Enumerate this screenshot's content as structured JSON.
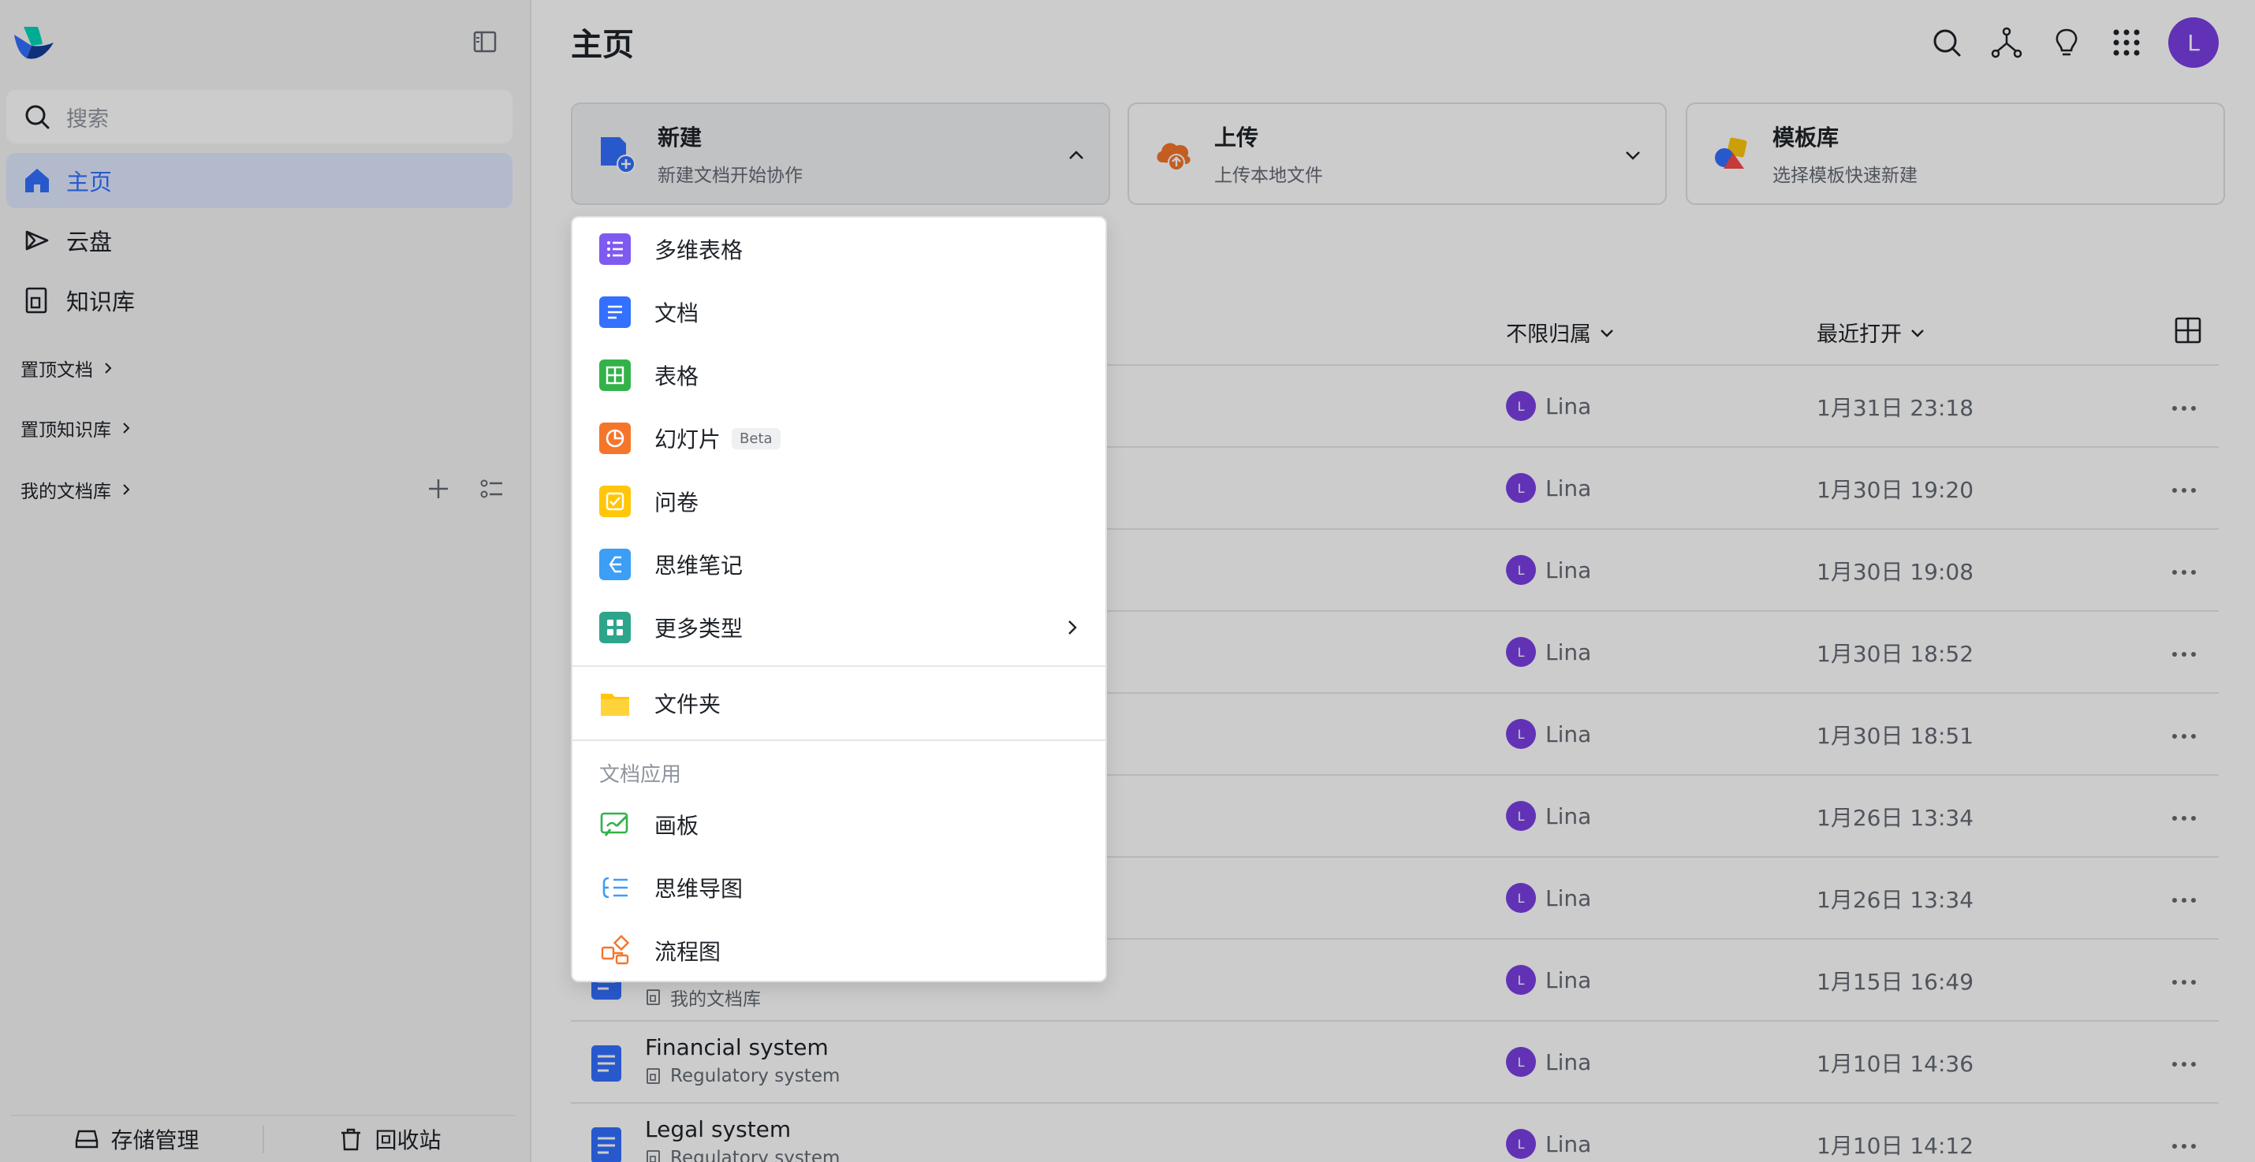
{
  "sidebar": {
    "search_placeholder": "搜索",
    "nav": [
      {
        "label": "主页",
        "icon": "home-icon",
        "active": true
      },
      {
        "label": "云盘",
        "icon": "cloud-drive-icon",
        "active": false
      },
      {
        "label": "知识库",
        "icon": "wiki-icon",
        "active": false
      }
    ],
    "sections": [
      "置顶文档",
      "置顶知识库",
      "我的文档库"
    ],
    "bottom": {
      "storage": "存储管理",
      "trash": "回收站"
    }
  },
  "header": {
    "title": "主页",
    "avatar_initial": "L"
  },
  "cards": [
    {
      "title": "新建",
      "subtitle": "新建文档开始协作",
      "icon": "new-doc-icon"
    },
    {
      "title": "上传",
      "subtitle": "上传本地文件",
      "icon": "upload-cloud-icon"
    },
    {
      "title": "模板库",
      "subtitle": "选择模板快速新建",
      "icon": "template-shapes-icon"
    }
  ],
  "table": {
    "col_owner": "不限归属",
    "col_time": "最近打开",
    "rows": [
      {
        "name": "",
        "location": "",
        "owner": "Lina",
        "time": "1月31日 23:18"
      },
      {
        "name": "",
        "location": "",
        "owner": "Lina",
        "time": "1月30日 19:20"
      },
      {
        "name": "",
        "location": "",
        "owner": "Lina",
        "time": "1月30日 19:08"
      },
      {
        "name": "",
        "location": "",
        "owner": "Lina",
        "time": "1月30日 18:52"
      },
      {
        "name": "",
        "location": "",
        "owner": "Lina",
        "time": "1月30日 18:51"
      },
      {
        "name": "",
        "location": "",
        "owner": "Lina",
        "time": "1月26日 13:34"
      },
      {
        "name": "",
        "location": "",
        "owner": "Lina",
        "time": "1月26日 13:34"
      },
      {
        "name": "",
        "location": "我的文档库",
        "owner": "Lina",
        "time": "1月15日 16:49"
      },
      {
        "name": "Financial system",
        "location": "Regulatory system",
        "owner": "Lina",
        "time": "1月10日 14:36"
      },
      {
        "name": "Legal system",
        "location": "Regulatory system",
        "owner": "Lina",
        "time": "1月10日 14:12"
      }
    ]
  },
  "dropdown": {
    "items": [
      {
        "label": "多维表格",
        "icon": "base-icon",
        "color": "#7f5af0"
      },
      {
        "label": "文档",
        "icon": "doc-icon",
        "color": "#3370ff"
      },
      {
        "label": "表格",
        "icon": "sheet-icon",
        "color": "#34b24a"
      },
      {
        "label": "幻灯片",
        "icon": "slides-icon",
        "color": "#f5752a",
        "badge": "Beta"
      },
      {
        "label": "问卷",
        "icon": "survey-icon",
        "color": "#ffc60a"
      },
      {
        "label": "思维笔记",
        "icon": "mindnote-icon",
        "color": "#3d9ef5"
      },
      {
        "label": "更多类型",
        "icon": "more-types-icon",
        "color": "#2ea58b"
      }
    ],
    "folder_label": "文件夹",
    "group_label": "文档应用",
    "apps": [
      {
        "label": "画板",
        "icon": "whiteboard-icon",
        "color": "#34b24a"
      },
      {
        "label": "思维导图",
        "icon": "mindmap-icon",
        "color": "#3d9ef5"
      },
      {
        "label": "流程图",
        "icon": "flowchart-icon",
        "color": "#f5752a"
      }
    ]
  }
}
